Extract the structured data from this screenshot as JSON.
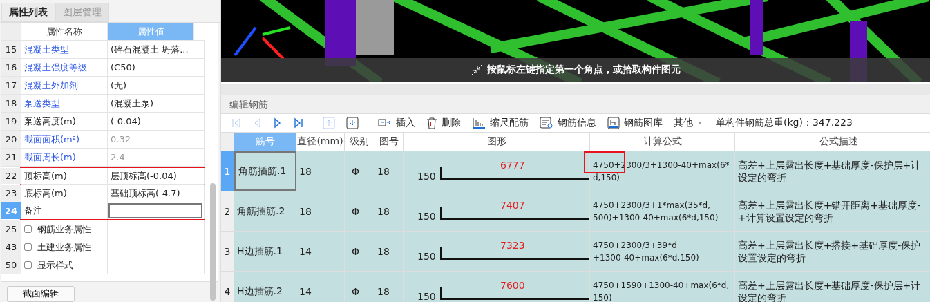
{
  "left_panel": {
    "tabs": [
      {
        "label": "属性列表",
        "selected": true
      },
      {
        "label": "图层管理",
        "selected": false
      }
    ],
    "columns": [
      {
        "label": "属性名称",
        "selected": false
      },
      {
        "label": "属性值",
        "selected": true
      }
    ],
    "rows": [
      {
        "num": "15",
        "name": "混凝土类型",
        "value": "(碎石混凝土 坍落...",
        "kind": "prop",
        "linked": true,
        "readonly": false,
        "selected": false,
        "highlighted": false
      },
      {
        "num": "16",
        "name": "混凝土强度等级",
        "value": "(C50)",
        "kind": "prop",
        "linked": true,
        "readonly": false,
        "selected": false,
        "highlighted": false
      },
      {
        "num": "17",
        "name": "混凝土外加剂",
        "value": "(无)",
        "kind": "prop",
        "linked": true,
        "readonly": false,
        "selected": false,
        "highlighted": false
      },
      {
        "num": "18",
        "name": "泵送类型",
        "value": "(混凝土泵)",
        "kind": "prop",
        "linked": true,
        "readonly": false,
        "selected": false,
        "highlighted": false
      },
      {
        "num": "19",
        "name": "泵送高度(m)",
        "value": "(-0.04)",
        "kind": "prop",
        "linked": false,
        "readonly": false,
        "selected": false,
        "highlighted": false
      },
      {
        "num": "20",
        "name": "截面面积(m²)",
        "value": "0.32",
        "kind": "prop",
        "linked": true,
        "readonly": true,
        "selected": false,
        "highlighted": false
      },
      {
        "num": "21",
        "name": "截面周长(m)",
        "value": "2.4",
        "kind": "prop",
        "linked": true,
        "readonly": true,
        "selected": false,
        "highlighted": false
      },
      {
        "num": "22",
        "name": "顶标高(m)",
        "value": "层顶标高(-0.04)",
        "kind": "prop",
        "linked": false,
        "readonly": false,
        "selected": false,
        "highlighted": true
      },
      {
        "num": "23",
        "name": "底标高(m)",
        "value": "基础顶标高(-4.7)",
        "kind": "prop",
        "linked": false,
        "readonly": false,
        "selected": false,
        "highlighted": true
      },
      {
        "num": "24",
        "name": "备注",
        "kind": "prop",
        "linked": false,
        "readonly": false,
        "selected": true,
        "highlighted": true
      },
      {
        "num": "25",
        "name": "钢筋业务属性",
        "kind": "group",
        "expanded": false
      },
      {
        "num": "43",
        "name": "土建业务属性",
        "kind": "group",
        "expanded": false
      },
      {
        "num": "50",
        "name": "显示样式",
        "kind": "group",
        "expanded": false
      }
    ],
    "bottom_button": "截面编辑"
  },
  "viewport": {
    "hint": "按鼠标左键指定第一个角点，或拾取构件图元"
  },
  "rebar_panel": {
    "title": "编辑钢筋",
    "toolbar": [
      {
        "kind": "first",
        "disabled": true
      },
      {
        "kind": "prev",
        "disabled": true
      },
      {
        "kind": "next",
        "disabled": false
      },
      {
        "kind": "last",
        "disabled": false
      },
      {
        "kind": "up",
        "disabled": true
      },
      {
        "kind": "down",
        "disabled": false
      },
      {
        "kind": "insert",
        "label": "插入",
        "disabled": false
      },
      {
        "kind": "delete",
        "label": "删除",
        "disabled": false
      },
      {
        "kind": "scale",
        "label": "缩尺配筋",
        "disabled": false
      },
      {
        "kind": "info",
        "label": "钢筋信息",
        "disabled": false
      },
      {
        "kind": "library",
        "label": "钢筋图库",
        "disabled": false
      },
      {
        "kind": "menu",
        "label": "其他",
        "disabled": false
      }
    ],
    "total_weight": "单构件钢筋总重(kg)：347.223",
    "columns": [
      {
        "label": "筋号",
        "selected": true
      },
      {
        "label": "直径(mm)",
        "selected": false
      },
      {
        "label": "级别",
        "selected": false
      },
      {
        "label": "图号",
        "selected": false
      },
      {
        "label": "图形",
        "selected": false
      },
      {
        "label": "计算公式",
        "selected": false
      },
      {
        "label": "公式描述",
        "selected": false
      }
    ],
    "rows": [
      {
        "num": "1",
        "selected": true,
        "name": "角筋插筋.1",
        "diameter": "18",
        "grade": "Φ",
        "shape_no": "18",
        "hook": "150",
        "length": "6777",
        "formula": [
          "4750+2300/3+1300-40+max(6*",
          "d,150)"
        ],
        "formula_highlighted": true,
        "description": [
          "高差+上层露出长度+基础厚度-保护层+计",
          "设定的弯折"
        ]
      },
      {
        "num": "2",
        "selected": false,
        "name": "角筋插筋.2",
        "diameter": "18",
        "grade": "Φ",
        "shape_no": "18",
        "hook": "150",
        "length": "7407",
        "formula": [
          "4750+2300/3+1*max(35*d,",
          "500)+1300-40+max(6*d,150)"
        ],
        "formula_highlighted": false,
        "description": [
          "高差+上层露出长度+错开距离+基础厚度-",
          "+计算设置设定的弯折"
        ]
      },
      {
        "num": "3",
        "selected": false,
        "name": "H边插筋.1",
        "diameter": "14",
        "grade": "Φ",
        "shape_no": "18",
        "hook": "150",
        "length": "7323",
        "formula": [
          "4750+2300/3+39*d",
          "+1300-40+max(6*d,150)"
        ],
        "formula_highlighted": false,
        "description": [
          "高差+上层露出长度+搭接+基础厚度-保护",
          "设置设定的弯折"
        ]
      },
      {
        "num": "4",
        "selected": false,
        "name": "H边插筋.2",
        "diameter": "14",
        "grade": "Φ",
        "shape_no": "18",
        "hook": "150",
        "length": "7600",
        "formula": [
          "4750+1590+1300-40+max(6*d,",
          "150)"
        ],
        "formula_highlighted": false,
        "description": [
          "高差+上层露出长度+基础厚度-保护层+计",
          "设定的弯折"
        ]
      }
    ]
  }
}
